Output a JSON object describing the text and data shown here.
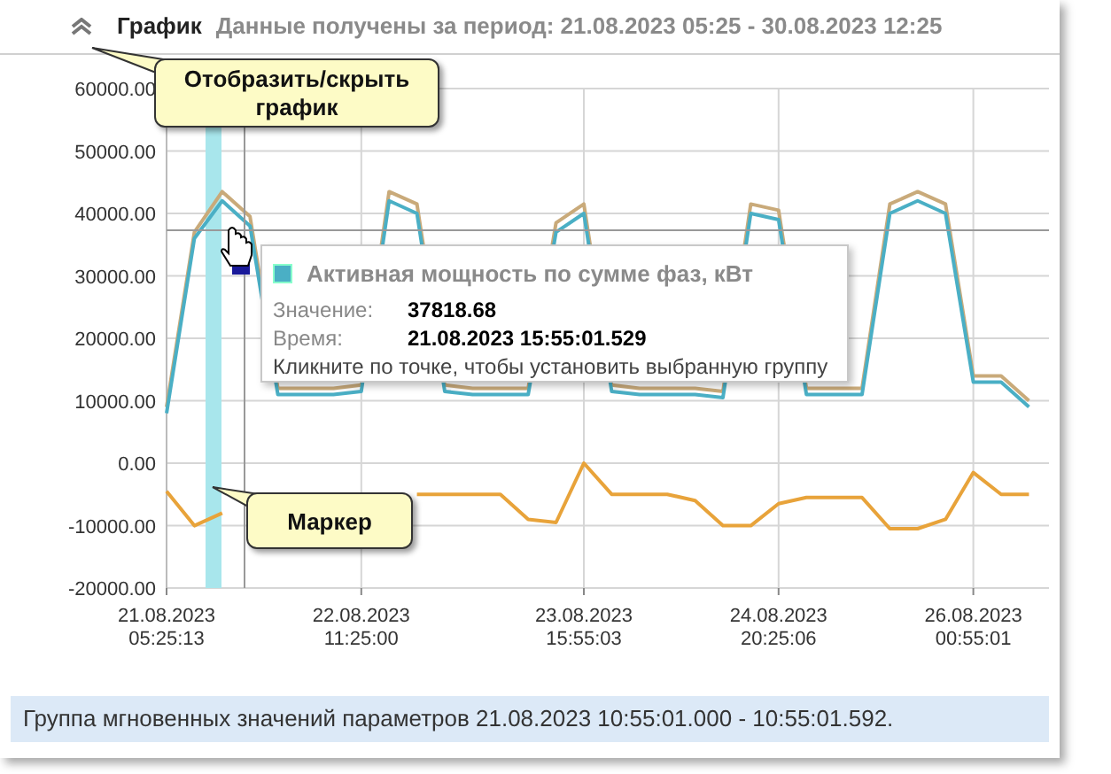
{
  "header": {
    "title": "График",
    "period": "Данные получены за период: 21.08.2023 05:25 - 30.08.2023 12:25"
  },
  "chart": {
    "chart_data": {
      "type": "line",
      "grid": true,
      "ref_lines": [
        {
          "axis": "y",
          "value": 37305
        }
      ],
      "ylim": [
        -20000,
        60000
      ],
      "yticks": [
        {
          "value": -20000,
          "label": "-20000.00"
        },
        {
          "value": -10000,
          "label": "-10000.00"
        },
        {
          "value": 0,
          "label": "0.00"
        },
        {
          "value": 10000,
          "label": "10000.00"
        },
        {
          "value": 20000,
          "label": "20000.00"
        },
        {
          "value": 30000,
          "label": "30000.00"
        },
        {
          "value": 40000,
          "label": "40000.00"
        },
        {
          "value": 50000,
          "label": "50000.00"
        },
        {
          "value": 60000,
          "label": "60000.00"
        }
      ],
      "categories": [
        "21.08.2023\n05:25:13",
        null,
        null,
        null,
        null,
        null,
        null,
        "22.08.2023\n11:25:00",
        null,
        null,
        null,
        null,
        null,
        null,
        null,
        "23.08.2023\n15:55:03",
        null,
        null,
        null,
        null,
        null,
        null,
        "24.08.2023\n20:25:06",
        null,
        null,
        null,
        null,
        null,
        null,
        "26.08.2023\n00:55:01",
        null,
        null
      ],
      "series": [
        {
          "name": "Активная мощность по сумме фаз, кВт",
          "color": "#4aafc5",
          "values": [
            8000,
            36000,
            42000,
            38000,
            11000,
            11000,
            11000,
            11500,
            42000,
            40000,
            11500,
            11000,
            11000,
            11000,
            37000,
            40000,
            11500,
            11000,
            11000,
            11000,
            10500,
            40000,
            39000,
            11000,
            11000,
            11000,
            40000,
            42000,
            40000,
            13000,
            13000,
            9000
          ]
        },
        {
          "color": "#c9aa7a",
          "values": [
            9000,
            37000,
            43500,
            39500,
            12000,
            12000,
            12000,
            12500,
            43500,
            41500,
            12500,
            12000,
            12000,
            12000,
            38500,
            41500,
            12500,
            12000,
            12000,
            12000,
            11500,
            41500,
            40500,
            12000,
            12000,
            12000,
            41500,
            43500,
            41500,
            14000,
            14000,
            10000
          ]
        },
        {
          "color": "#e8a33a",
          "values": [
            -4500,
            -10000,
            -8000,
            null,
            null,
            null,
            null,
            null,
            null,
            -5000,
            -5000,
            -5000,
            -5000,
            -9000,
            -9500,
            0,
            -5000,
            -5000,
            -5000,
            -6000,
            -10000,
            -10000,
            -6500,
            -5500,
            -5500,
            -5500,
            -10500,
            -10500,
            -9000,
            -1500,
            -5000,
            -5000
          ]
        }
      ]
    }
  },
  "tooltip": {
    "rows": [
      {
        "label": "Значение:",
        "value": "37818.68"
      },
      {
        "label": "Время:",
        "value": "21.08.2023 15:55:01.529"
      }
    ],
    "hint": "Кликните по точке, чтобы установить выбранную группу"
  },
  "callouts": [
    {
      "text": "Отобразить/скрыть график"
    },
    {
      "text": "Маркер"
    }
  ],
  "status_bar": {
    "text": "Группа мгновенных значений параметров 21.08.2023 10:55:01.000 - 10:55:01.592."
  }
}
